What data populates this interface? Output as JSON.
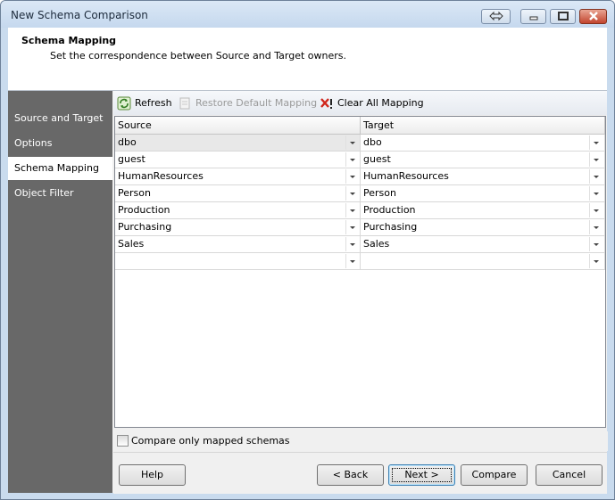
{
  "window": {
    "title": "New Schema Comparison"
  },
  "header": {
    "title": "Schema Mapping",
    "subtitle": "Set the correspondence between Source and Target owners."
  },
  "sidebar": {
    "items": [
      {
        "label": "Source and Target",
        "active": false
      },
      {
        "label": "Options",
        "active": false
      },
      {
        "label": "Schema Mapping",
        "active": true
      },
      {
        "label": "Object Filter",
        "active": false
      }
    ]
  },
  "toolbar": {
    "refresh_label": "Refresh",
    "restore_label": "Restore Default Mapping",
    "clear_label": "Clear All Mapping"
  },
  "grid": {
    "columns": [
      "Source",
      "Target"
    ],
    "rows": [
      {
        "source": "dbo",
        "target": "dbo"
      },
      {
        "source": "guest",
        "target": "guest"
      },
      {
        "source": "HumanResources",
        "target": "HumanResources"
      },
      {
        "source": "Person",
        "target": "Person"
      },
      {
        "source": "Production",
        "target": "Production"
      },
      {
        "source": "Purchasing",
        "target": "Purchasing"
      },
      {
        "source": "Sales",
        "target": "Sales"
      },
      {
        "source": "",
        "target": ""
      }
    ]
  },
  "options": {
    "compare_only_mapped_label": "Compare only mapped schemas",
    "compare_only_mapped_checked": false
  },
  "buttons": {
    "help": "Help",
    "back": "< Back",
    "next": "Next >",
    "compare": "Compare",
    "cancel": "Cancel"
  },
  "colors": {
    "sidebar": "#686868",
    "titlebar": "#c5d8ee",
    "close": "#c2452f"
  }
}
